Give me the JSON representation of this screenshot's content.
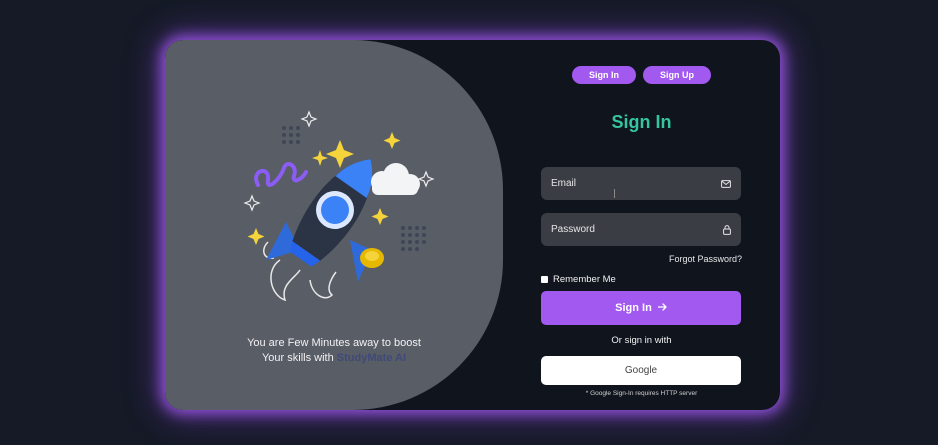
{
  "tabs": [
    "Sign In",
    "Sign Up"
  ],
  "form": {
    "title": "Sign In",
    "email_placeholder": "Email",
    "password_placeholder": "Password",
    "forgot_password": "Forgot Password?",
    "remember_me": "Remember Me",
    "submit_label": "Sign In",
    "or_text": "Or sign in with",
    "google_label": "Google",
    "note": "* Google Sign-In requires HTTP server"
  },
  "promo": {
    "line1": "You are Few Minutes away to boost",
    "line2_prefix": "Your skills with ",
    "brand": "StudyMate AI"
  },
  "icons": {
    "email": "mail-icon",
    "password": "lock-icon",
    "submit": "arrow-right-icon",
    "illustration": "rocket-illustration"
  },
  "colors": {
    "accent": "#a259f0",
    "title": "#35c4a0",
    "card": "#0f141d",
    "panel": "#595d66"
  }
}
